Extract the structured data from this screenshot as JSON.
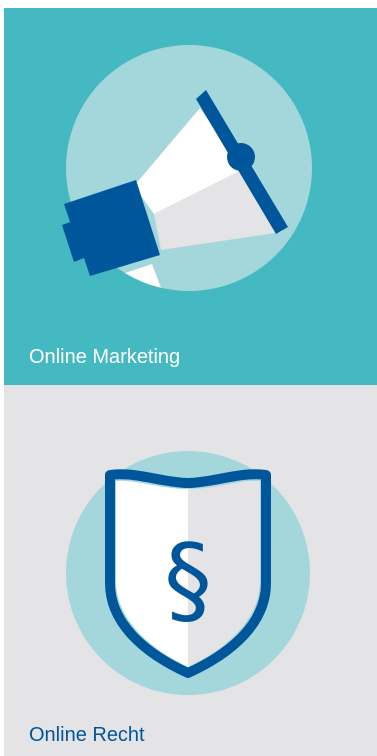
{
  "tiles": [
    {
      "label": "Online Marketing",
      "icon": "megaphone-icon",
      "background_color": "#44b9c1",
      "circle_color": "#a3d7db",
      "accent_color": "#00569b",
      "label_color": "#ffffff"
    },
    {
      "label": "Online Recht",
      "icon": "shield-paragraph-icon",
      "background_color": "#e4e3e6",
      "circle_color": "#a3d7db",
      "accent_color": "#00569b",
      "label_color": "#00569b"
    }
  ]
}
